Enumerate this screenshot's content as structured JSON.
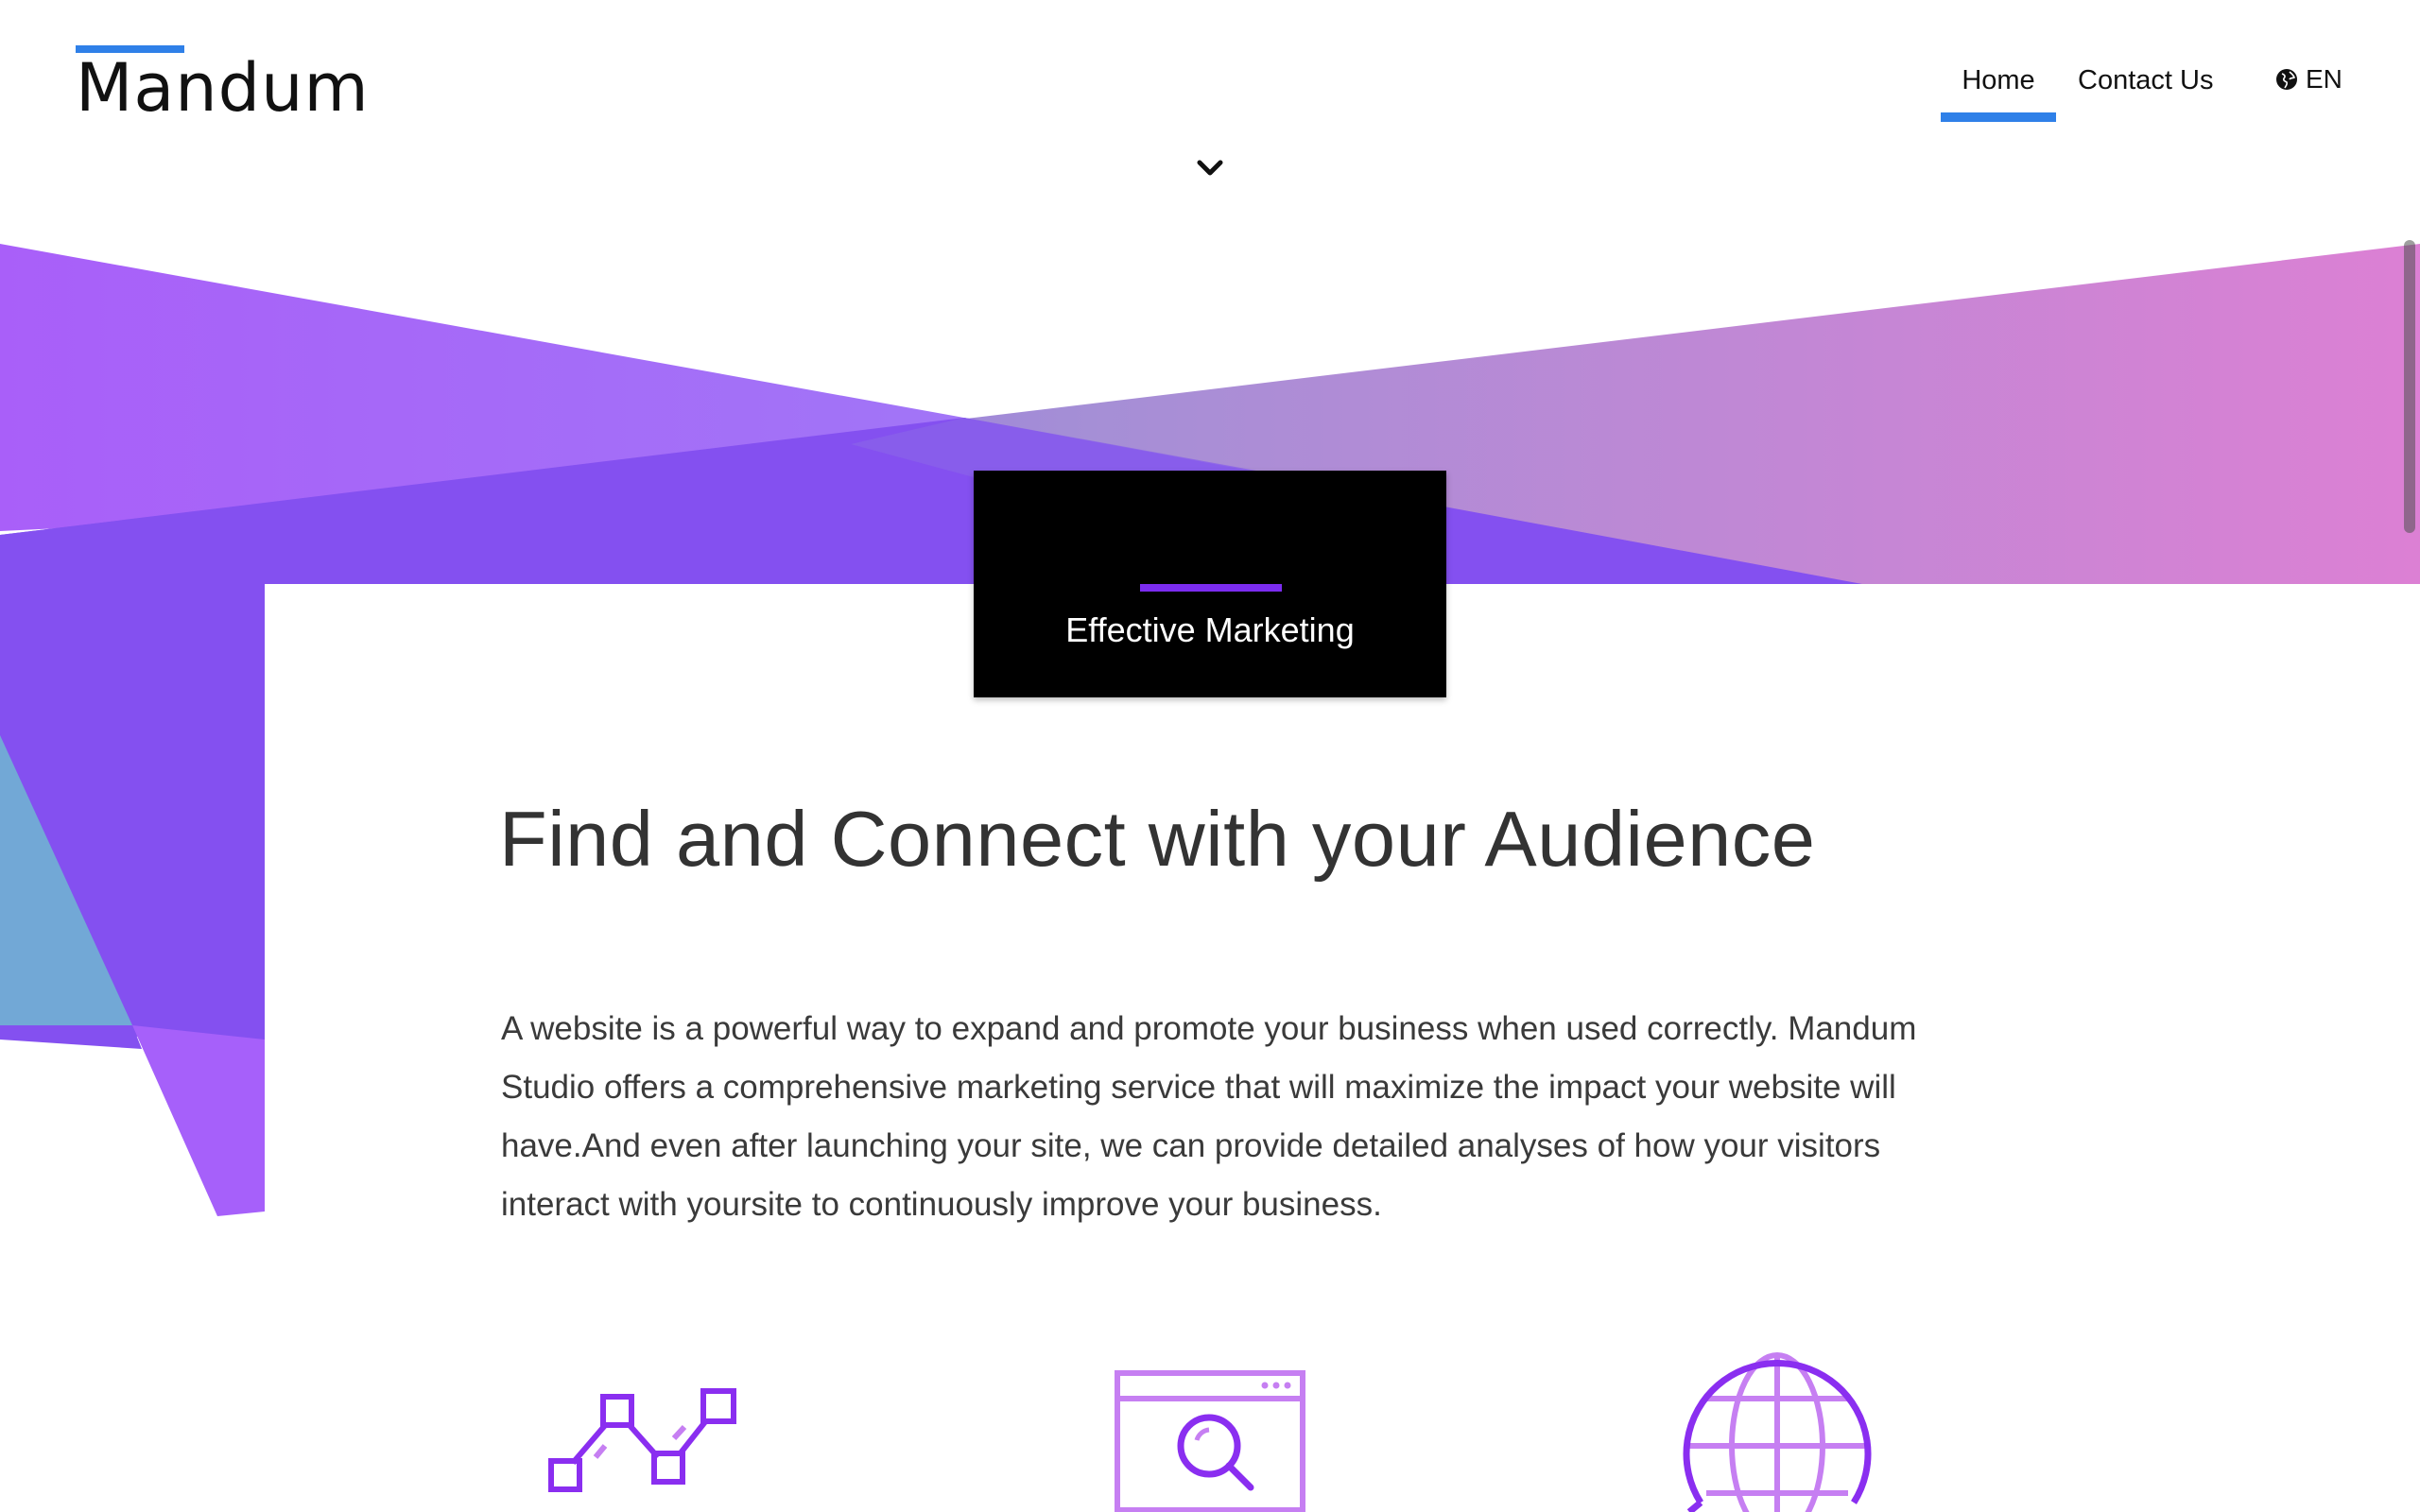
{
  "header": {
    "logo_text": "Mandum",
    "nav": {
      "home_label": "Home",
      "contact_label": "Contact Us"
    },
    "language_label": "EN"
  },
  "hero": {
    "tag_label": "Effective Marketing",
    "headline": "Find and Connect with your Audience",
    "body": "A website is a powerful way to expand and promote your business when used correctly. Mandum Studio offers a comprehensive marketing service that will maximize the impact your website will have.And even after launching your site, we can provide detailed analyses of how your visitors interact with yoursite to continuously improve your business."
  },
  "features": {
    "icons": [
      "analytics-chart-icon",
      "browser-search-icon",
      "globe-chat-icon"
    ]
  },
  "colors": {
    "accent_blue": "#2f80e8",
    "accent_purple": "#7b2cf0",
    "gradient_purple": "#a65ef8",
    "gradient_pink": "#d980d6",
    "icon_purple": "#8a2ef0",
    "icon_lavender": "#c67ff2"
  }
}
